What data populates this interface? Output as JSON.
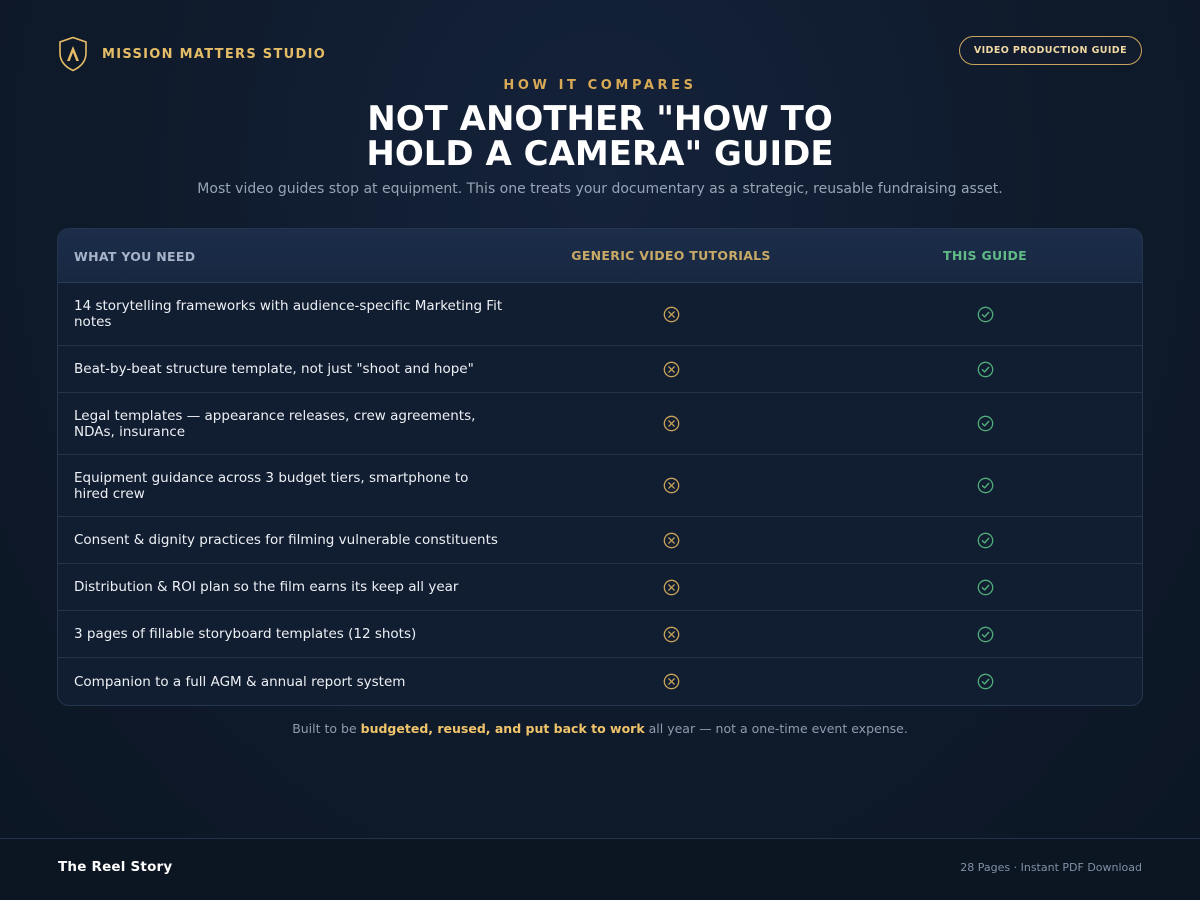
{
  "header": {
    "brand_name": "MISSION MATTERS STUDIO",
    "badge_label": "VIDEO PRODUCTION GUIDE"
  },
  "hero": {
    "eyebrow": "HOW IT COMPARES",
    "title_line1": "NOT ANOTHER \"HOW TO",
    "title_line2": "HOLD A CAMERA\" GUIDE",
    "subtitle": "Most video guides stop at equipment. This one treats your documentary as a strategic, reusable fundraising asset."
  },
  "table": {
    "headers": {
      "need": "WHAT YOU NEED",
      "generic": "GENERIC VIDEO TUTORIALS",
      "this": "THIS GUIDE"
    },
    "rows": [
      {
        "need": "14 storytelling frameworks with audience-specific Marketing Fit notes",
        "generic": "x-circle-icon",
        "this": "check-circle-icon"
      },
      {
        "need": "Beat-by-beat structure template, not just \"shoot and hope\"",
        "generic": "x-circle-icon",
        "this": "check-circle-icon"
      },
      {
        "need": "Legal templates — appearance releases, crew agreements, NDAs, insurance",
        "generic": "x-circle-icon",
        "this": "check-circle-icon"
      },
      {
        "need": "Equipment guidance across 3 budget tiers, smartphone to hired crew",
        "generic": "x-circle-icon",
        "this": "check-circle-icon"
      },
      {
        "need": "Consent & dignity practices for filming vulnerable constituents",
        "generic": "x-circle-icon",
        "this": "check-circle-icon"
      },
      {
        "need": "Distribution & ROI plan so the film earns its keep all year",
        "generic": "x-circle-icon",
        "this": "check-circle-icon"
      },
      {
        "need": "3 pages of fillable storyboard templates (12 shots)",
        "generic": "x-circle-icon",
        "this": "check-circle-icon"
      },
      {
        "need": "Companion to a full AGM & annual report system",
        "generic": "x-circle-icon",
        "this": "check-circle-icon"
      }
    ]
  },
  "note": {
    "prefix": "Built to be ",
    "highlight": "budgeted, reused, and put back to work",
    "suffix": " all year — not a one-time event expense."
  },
  "footer": {
    "left": "The Reel Story",
    "right": "28 Pages · Instant PDF Download"
  },
  "colors": {
    "background": "#0f1a2b",
    "accent_gold": "#e6bd67",
    "accent_green": "#5fba86",
    "x_icon": "#c9a35a",
    "check_icon": "#4fae7a"
  }
}
